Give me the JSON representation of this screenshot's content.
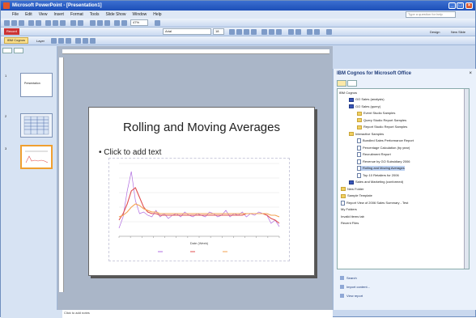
{
  "window": {
    "title": "Microsoft PowerPoint - [Presentation1]"
  },
  "menu": [
    "File",
    "Edit",
    "View",
    "Insert",
    "Format",
    "Tools",
    "Slide Show",
    "Window",
    "Help"
  ],
  "ask_question": "Type a question for help",
  "toolbar": {
    "font_name": "Arial",
    "zoom": "47%",
    "design_label": "Design",
    "new_slide_label": "New Slide",
    "cognos_button": "IBM Cognos",
    "layer_label": "Layer"
  },
  "left_pane": {
    "slides": [
      {
        "num": "1",
        "label": "Presentation"
      },
      {
        "num": "2",
        "label": ""
      },
      {
        "num": "3",
        "label": ""
      }
    ]
  },
  "slide": {
    "title": "Rolling and Moving Averages",
    "placeholder": "Click to add text"
  },
  "chart_data": {
    "type": "line",
    "x": [
      0,
      1,
      2,
      3,
      4,
      5,
      6,
      7,
      8,
      9,
      10,
      11,
      12,
      13,
      14,
      15,
      16,
      17,
      18,
      19,
      20,
      21,
      22,
      23,
      24,
      25,
      26,
      27,
      28,
      29,
      30,
      31,
      32,
      33,
      34,
      35,
      36,
      37,
      38,
      39
    ],
    "series": [
      {
        "name": "",
        "values": [
          5,
          12,
          28,
          40,
          22,
          14,
          15,
          13,
          12,
          16,
          12,
          14,
          11,
          13,
          14,
          12,
          15,
          13,
          12,
          14,
          13,
          12,
          15,
          14,
          12,
          13,
          16,
          12,
          14,
          13,
          15,
          12,
          14,
          13,
          15,
          14,
          13,
          8,
          10,
          6
        ]
      },
      {
        "name": "",
        "values": [
          10,
          14,
          20,
          28,
          30,
          24,
          18,
          15,
          14,
          14,
          13,
          13,
          13,
          13,
          13,
          13,
          13,
          13,
          13,
          13,
          13,
          13,
          13,
          13,
          13,
          13,
          13,
          13,
          13,
          13,
          13,
          14,
          14,
          14,
          14,
          14,
          13,
          11,
          10,
          8
        ]
      },
      {
        "name": "",
        "values": [
          12,
          13,
          15,
          18,
          20,
          19,
          17,
          16,
          15,
          15,
          14,
          14,
          14,
          14,
          14,
          14,
          14,
          14,
          14,
          14,
          14,
          14,
          14,
          14,
          14,
          14,
          14,
          14,
          14,
          14,
          14,
          14,
          14,
          14,
          14,
          14,
          14,
          13,
          13,
          12
        ]
      }
    ],
    "colors": [
      "#b06de0",
      "#e05050",
      "#f3a050"
    ],
    "xlabel": "Date (Week)",
    "ylim": [
      0,
      45
    ],
    "grid": true,
    "legend": "bottom"
  },
  "task_pane": {
    "title": "IBM Cognos for Microsoft Office",
    "root_label": "IBM Cognos",
    "tree": [
      {
        "label": "GO Sales (analysis)",
        "icon": "pkg",
        "indent": 1
      },
      {
        "label": "GO Sales (query)",
        "icon": "pkg",
        "indent": 1
      },
      {
        "label": "Event Studio Samples",
        "icon": "folder",
        "indent": 2
      },
      {
        "label": "Query Studio Report Samples",
        "icon": "folder",
        "indent": 2
      },
      {
        "label": "Report Studio Report Samples",
        "icon": "folder",
        "indent": 2
      },
      {
        "label": "Interactive Samples",
        "icon": "folder",
        "indent": 1
      },
      {
        "label": "Bundled Sales Performance Report",
        "icon": "rep",
        "indent": 2
      },
      {
        "label": "Percentage Calculation (by year)",
        "icon": "rep",
        "indent": 2
      },
      {
        "label": "Recruitment Report",
        "icon": "rep",
        "indent": 2
      },
      {
        "label": "Revenue by GO Subsidiary 2006",
        "icon": "rep",
        "indent": 2
      },
      {
        "label": "Rolling and Moving Averages",
        "icon": "rep",
        "indent": 2,
        "selected": true
      },
      {
        "label": "Top 10 Retailers for 2006",
        "icon": "rep",
        "indent": 2
      },
      {
        "label": "Sales and Marketing (conformed)",
        "icon": "pkg",
        "indent": 1
      },
      {
        "label": "New Folder",
        "icon": "folder",
        "indent": 0
      },
      {
        "label": "Sample Template",
        "icon": "folder",
        "indent": 0
      },
      {
        "label": "Report View of 2006 Sales Summary - Test",
        "icon": "rep",
        "indent": 0
      },
      {
        "label": "My Folders",
        "icon": "",
        "indent": 0
      },
      {
        "label": "Invalid items tab",
        "icon": "",
        "indent": 0
      },
      {
        "label": "Recent Files",
        "icon": "",
        "indent": 0
      }
    ],
    "links": [
      "Search",
      "Import content...",
      "View report"
    ]
  },
  "notes_placeholder": "Click to add notes"
}
